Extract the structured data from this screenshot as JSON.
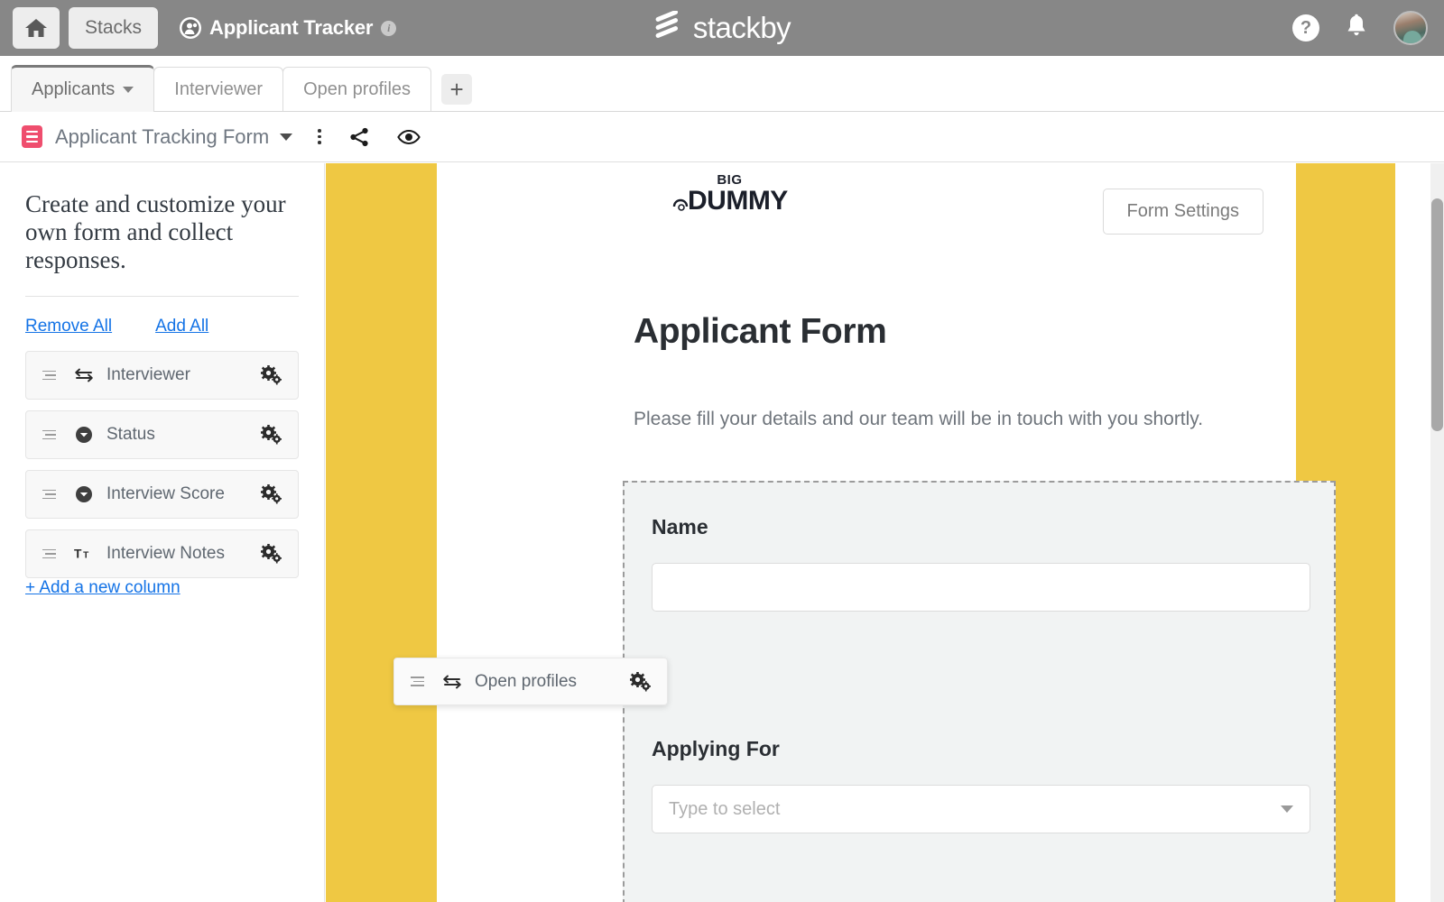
{
  "header": {
    "home_icon": "home-icon",
    "stacks_label": "Stacks",
    "stack_icon": "people-avatar-icon",
    "stack_title": "Applicant Tracker",
    "info_icon": "info-icon",
    "info_glyph": "i",
    "brand_name": "stackby",
    "brand_logo_icon": "stackby-logo-icon",
    "help_icon": "help-question-icon",
    "help_glyph": "?",
    "notification_icon": "bell-icon",
    "avatar_icon": "user-avatar"
  },
  "tabs": {
    "items": [
      {
        "label": "Applicants",
        "active": true,
        "has_caret": true
      },
      {
        "label": "Interviewer",
        "active": false,
        "has_caret": false
      },
      {
        "label": "Open profiles",
        "active": false,
        "has_caret": false
      }
    ],
    "add_label": "+",
    "add_icon": "plus-icon"
  },
  "form_toolbar": {
    "form_icon": "form-view-icon",
    "form_name": "Applicant Tracking Form",
    "caret_icon": "chevron-down-icon",
    "more_icon": "more-vertical-icon",
    "share_icon": "share-icon",
    "preview_icon": "eye-icon"
  },
  "left_panel": {
    "heading": "Create and customize your own form and collect responses.",
    "remove_all_label": "Remove All",
    "add_all_label": "Add All",
    "columns": [
      {
        "label": "Interviewer",
        "type_icon": "link-arrows-icon",
        "handle_icon": "drag-handle-icon",
        "settings_icon": "gear-icon"
      },
      {
        "label": "Status",
        "type_icon": "single-select-icon",
        "handle_icon": "drag-handle-icon",
        "settings_icon": "gear-icon"
      },
      {
        "label": "Interview Score",
        "type_icon": "single-select-icon",
        "handle_icon": "drag-handle-icon",
        "settings_icon": "gear-icon"
      },
      {
        "label": "Interview Notes",
        "type_icon": "long-text-icon",
        "handle_icon": "drag-handle-icon",
        "settings_icon": "gear-icon"
      }
    ],
    "add_column_label": "+ Add a new column"
  },
  "drag_ghost": {
    "label": "Open profiles",
    "type_icon": "link-arrows-icon",
    "handle_icon": "drag-handle-icon",
    "settings_icon": "gear-icon"
  },
  "form_canvas": {
    "logo_top": "BIG",
    "logo_bottom": "DUMMY",
    "logo_mark_icon": "dummy-mark-icon",
    "settings_button_label": "Form Settings",
    "title": "Applicant Form",
    "description": "Please fill your details and our team will be in touch with you shortly.",
    "fields": [
      {
        "label": "Name",
        "value": "",
        "placeholder": "",
        "control": "text"
      },
      {
        "label": "Applying For",
        "value": "",
        "placeholder": "Type to select",
        "control": "select"
      }
    ]
  },
  "colors": {
    "brand_yellow": "#efc843",
    "topbar_gray": "#878787",
    "form_icon_pink": "#ef4e6e",
    "link_blue": "#1473e6"
  }
}
